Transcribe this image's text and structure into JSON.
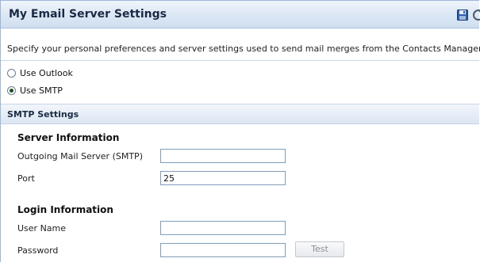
{
  "header": {
    "title": "My Email Server Settings",
    "icons": [
      "save-icon",
      "refresh-icon"
    ]
  },
  "description": "Specify your personal preferences and server settings used to send mail merges from the Contacts Manager.",
  "mail_options": [
    {
      "label": "Use Outlook",
      "selected": false
    },
    {
      "label": "Use SMTP",
      "selected": true
    }
  ],
  "smtp": {
    "section_title": "SMTP Settings",
    "server_info": {
      "heading": "Server Information",
      "outgoing_label": "Outgoing Mail Server (SMTP)",
      "outgoing_value": "",
      "port_label": "Port",
      "port_value": "25"
    },
    "login_info": {
      "heading": "Login Information",
      "username_label": "User Name",
      "username_value": "",
      "password_label": "Password",
      "password_value": "",
      "test_label": "Test"
    }
  },
  "colors": {
    "header_bg": "#dde8f5",
    "border": "#9bb7d8",
    "title_text": "#1a2a44"
  }
}
